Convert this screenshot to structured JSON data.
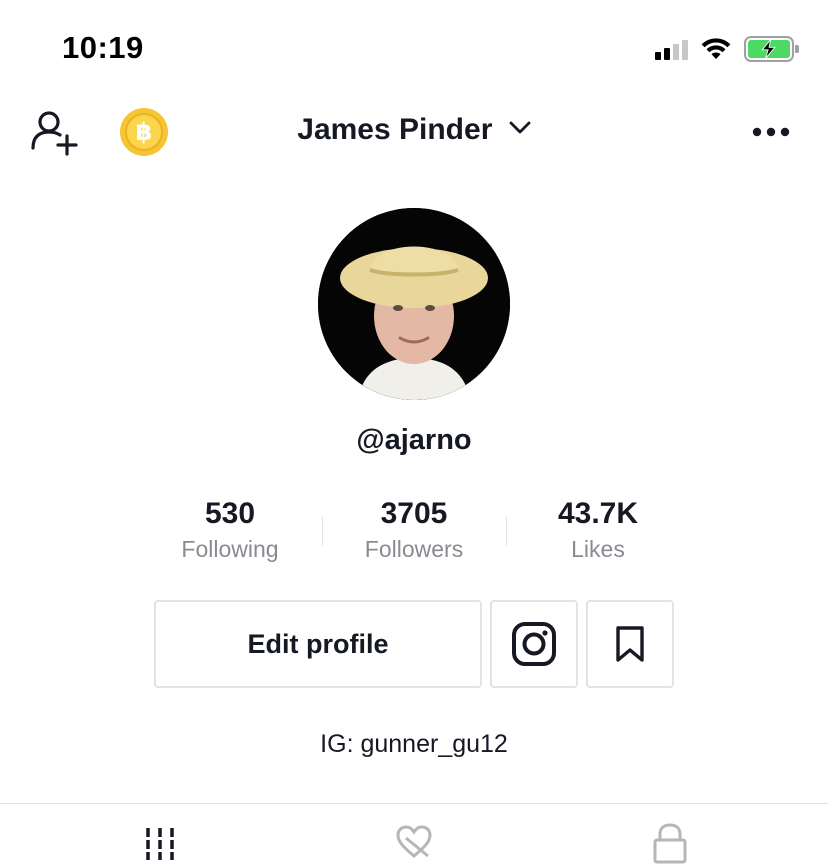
{
  "status_bar": {
    "time": "10:19",
    "icons": [
      "signal-icon",
      "wifi-icon",
      "battery-charging-icon"
    ]
  },
  "header": {
    "title": "James Pinder",
    "left_icons": [
      "add-user-icon",
      "coin-icon"
    ],
    "right_icon": "more-icon",
    "title_icon": "chevron-down-icon"
  },
  "profile": {
    "handle": "@ajarno",
    "stats": [
      {
        "value": "530",
        "label": "Following"
      },
      {
        "value": "3705",
        "label": "Followers"
      },
      {
        "value": "43.7K",
        "label": "Likes"
      }
    ],
    "edit_button_label": "Edit profile",
    "bio": "IG: gunner_gu12"
  },
  "tabs": [
    "videos-grid-icon",
    "liked-icon",
    "private-lock-icon"
  ],
  "colors": {
    "text": "#161823",
    "muted": "#8a8b91",
    "border": "#e3e3e4",
    "battery": "#4cd964",
    "coin": "#f7c533"
  }
}
